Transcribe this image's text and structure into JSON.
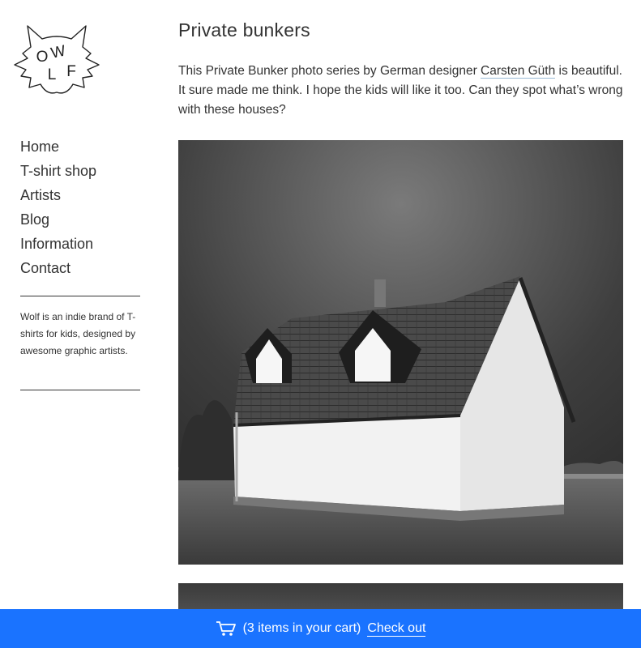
{
  "logo": {
    "text": "WOLF"
  },
  "nav": {
    "items": [
      "Home",
      "T-shirt shop",
      "Artists",
      "Blog",
      "Information",
      "Contact"
    ]
  },
  "sidebar": {
    "blurb": "Wolf is an indie brand of T-shirts for kids, designed by awesome graphic artists."
  },
  "post": {
    "title": "Private bunkers",
    "intro_before": "This Private Bunker photo series by German designer ",
    "intro_link": "Carsten Güth",
    "intro_after": " is beautiful. It sure made me think. I hope the kids will like it too. Can they spot what’s wrong with these houses?"
  },
  "cart": {
    "icon": "shopping-cart-icon",
    "count_text": "(3 items in your cart)",
    "checkout_label": "Check out",
    "bar_color": "#1a73ff"
  }
}
